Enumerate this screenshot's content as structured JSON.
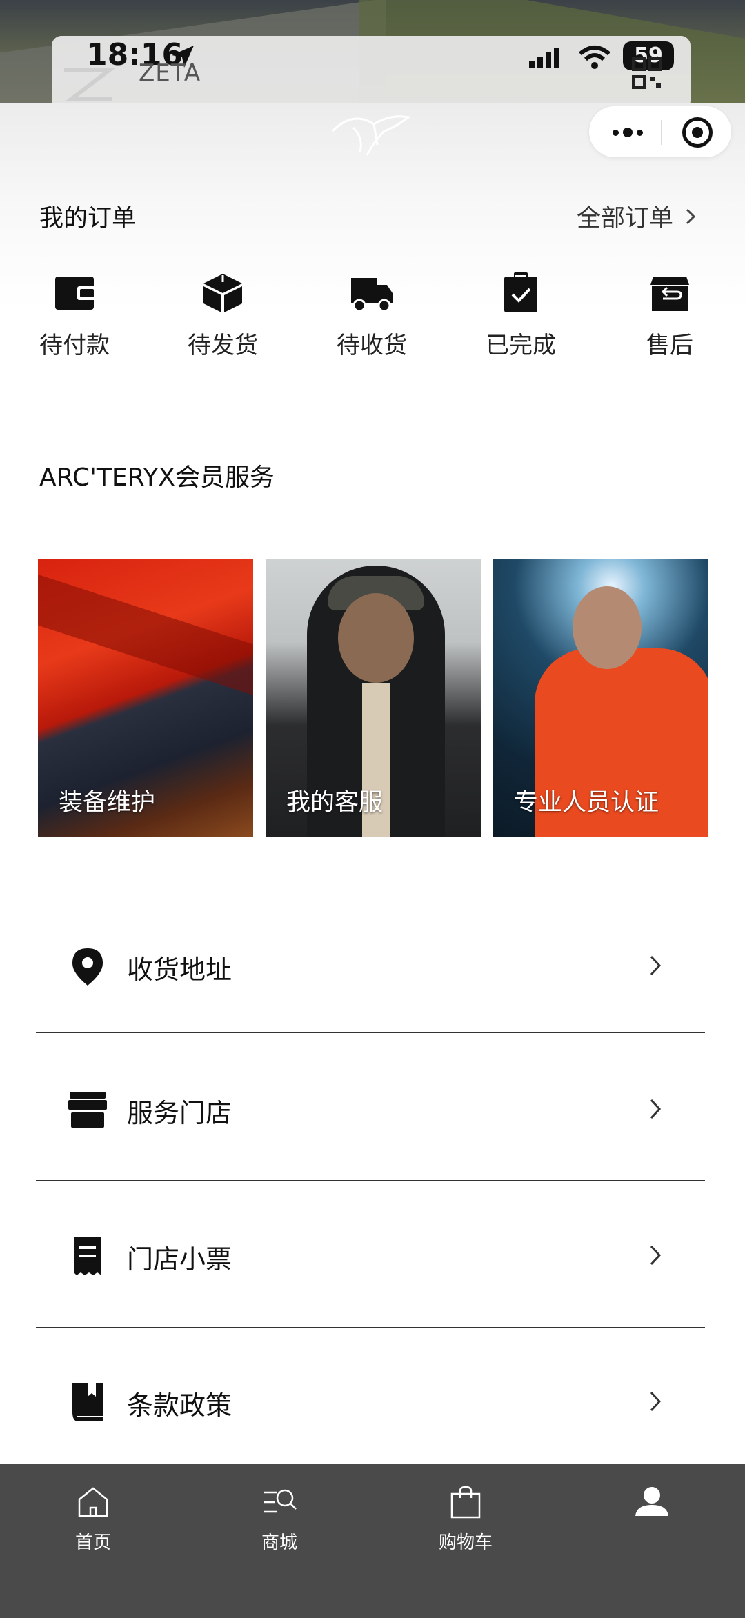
{
  "status_bar": {
    "time": "18:16",
    "battery": "59",
    "app_name": "ZETA"
  },
  "orders": {
    "title": "我的订单",
    "all_orders": "全部订单",
    "items": [
      {
        "label": "待付款",
        "icon": "wallet-icon"
      },
      {
        "label": "待发货",
        "icon": "package-icon"
      },
      {
        "label": "待收货",
        "icon": "truck-icon"
      },
      {
        "label": "已完成",
        "icon": "clipboard-check-icon"
      },
      {
        "label": "售后",
        "icon": "return-box-icon"
      }
    ]
  },
  "member": {
    "title": "ARC'TERYX会员服务",
    "cards": [
      {
        "label": "装备维护"
      },
      {
        "label": "我的客服"
      },
      {
        "label": "专业人员认证"
      }
    ]
  },
  "menu": [
    {
      "label": "收货地址",
      "icon": "location-pin-icon"
    },
    {
      "label": "服务门店",
      "icon": "store-icon"
    },
    {
      "label": "门店小票",
      "icon": "receipt-icon"
    },
    {
      "label": "条款政策",
      "icon": "book-icon"
    }
  ],
  "tabbar": [
    {
      "label": "首页",
      "icon": "home-icon"
    },
    {
      "label": "商城",
      "icon": "shop-search-icon"
    },
    {
      "label": "购物车",
      "icon": "shopping-bag-icon"
    },
    {
      "label": "",
      "icon": "profile-icon",
      "active": true
    }
  ],
  "colors": {
    "tabbar_bg": "#4a4a4a",
    "text_primary": "#111111",
    "divider": "#333333"
  }
}
